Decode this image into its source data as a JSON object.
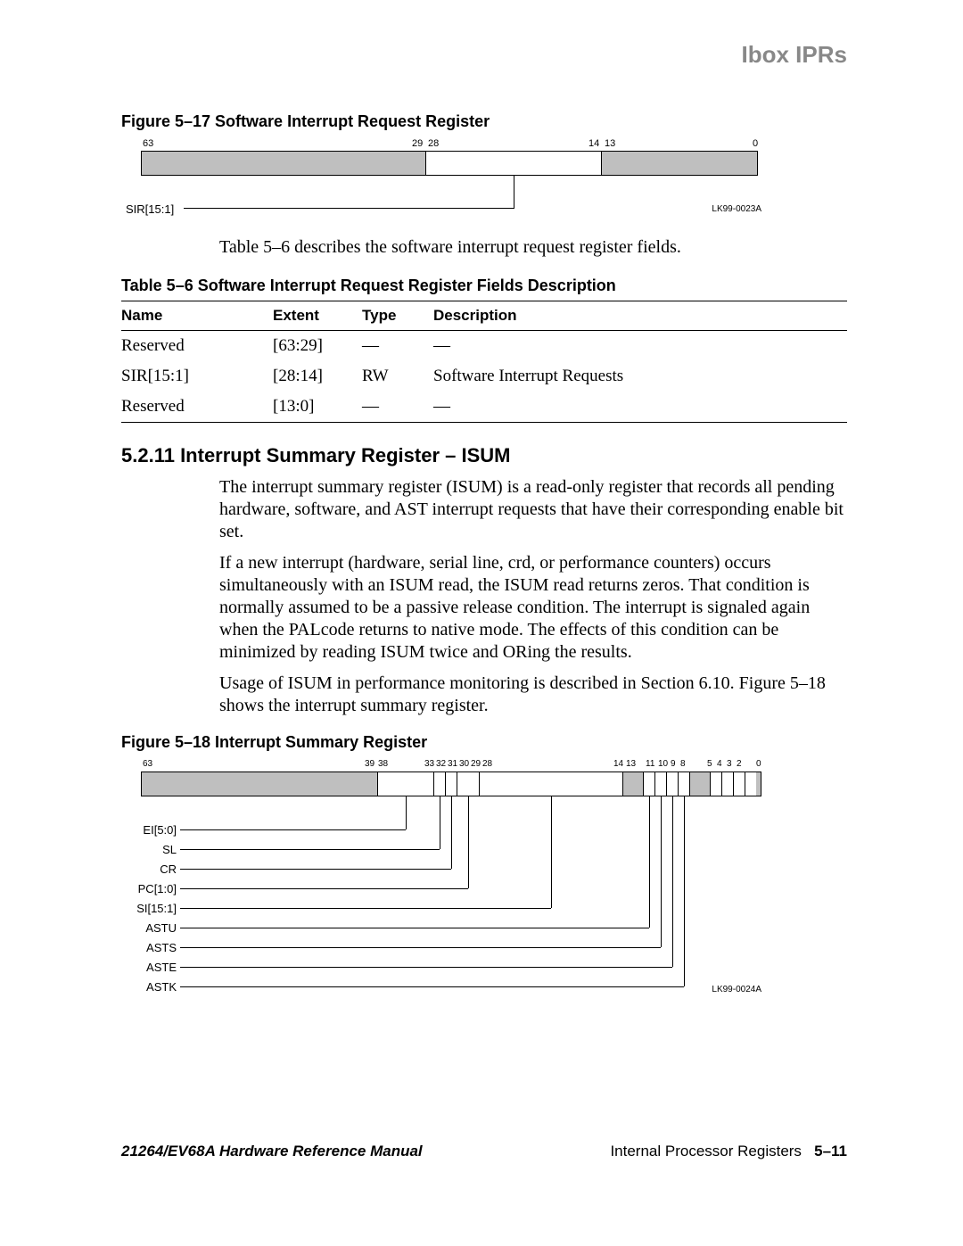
{
  "header": {
    "title": "Ibox IPRs"
  },
  "fig517": {
    "caption": "Figure 5–17  Software Interrupt Request Register",
    "bits": {
      "b63": "63",
      "b29": "29",
      "b28": "28",
      "b14": "14",
      "b13": "13",
      "b0": "0"
    },
    "label_sir": "SIR[15:1]",
    "lk": "LK99-0023A"
  },
  "lead_text": "Table 5–6 describes the software interrupt request register fields.",
  "table56": {
    "caption": "Table 5–6  Software Interrupt Request Register Fields Description",
    "headers": {
      "name": "Name",
      "extent": "Extent",
      "type": "Type",
      "desc": "Description"
    },
    "rows": [
      {
        "name": "Reserved",
        "extent": "[63:29]",
        "type": "—",
        "desc": "—"
      },
      {
        "name": "SIR[15:1]",
        "extent": "[28:14]",
        "type": "RW",
        "desc": "Software Interrupt Requests"
      },
      {
        "name": "Reserved",
        "extent": "[13:0]",
        "type": "—",
        "desc": "—"
      }
    ]
  },
  "section": {
    "heading": "5.2.11  Interrupt Summary Register – ISUM",
    "p1": "The interrupt summary register (ISUM) is a read-only register that records all pending hardware, software, and AST interrupt requests that have their corresponding enable bit set.",
    "p2": "If a new interrupt (hardware, serial line, crd, or performance counters) occurs simultaneously with an ISUM read, the ISUM read returns zeros. That condition is normally assumed to be a passive release condition. The interrupt is signaled again when the PALcode returns to native mode. The effects of this condition can be minimized by reading ISUM twice and ORing the results.",
    "p3": "Usage of ISUM in performance monitoring is described in Section 6.10. Figure 5–18 shows the interrupt summary register."
  },
  "fig518": {
    "caption": "Figure 5–18  Interrupt Summary Register",
    "bits": {
      "b63": "63",
      "b39": "39",
      "b38": "38",
      "b33": "33",
      "b32": "32",
      "b31": "31",
      "b30": "30",
      "b29": "29",
      "b28": "28",
      "b14": "14",
      "b13": "13",
      "b11": "11",
      "b10": "10",
      "b9": "9",
      "b8": "8",
      "b5": "5",
      "b4": "4",
      "b3": "3",
      "b2": "2",
      "b0": "0"
    },
    "labels": {
      "ei": "EI[5:0]",
      "sl": "SL",
      "cr": "CR",
      "pc": "PC[1:0]",
      "si": "SI[15:1]",
      "astu": "ASTU",
      "asts": "ASTS",
      "aste": "ASTE",
      "astk": "ASTK"
    },
    "lk": "LK99-0024A"
  },
  "footer": {
    "manual": "21264/EV68A Hardware Reference Manual",
    "chapter": "Internal Processor Registers",
    "page": "5–11"
  }
}
